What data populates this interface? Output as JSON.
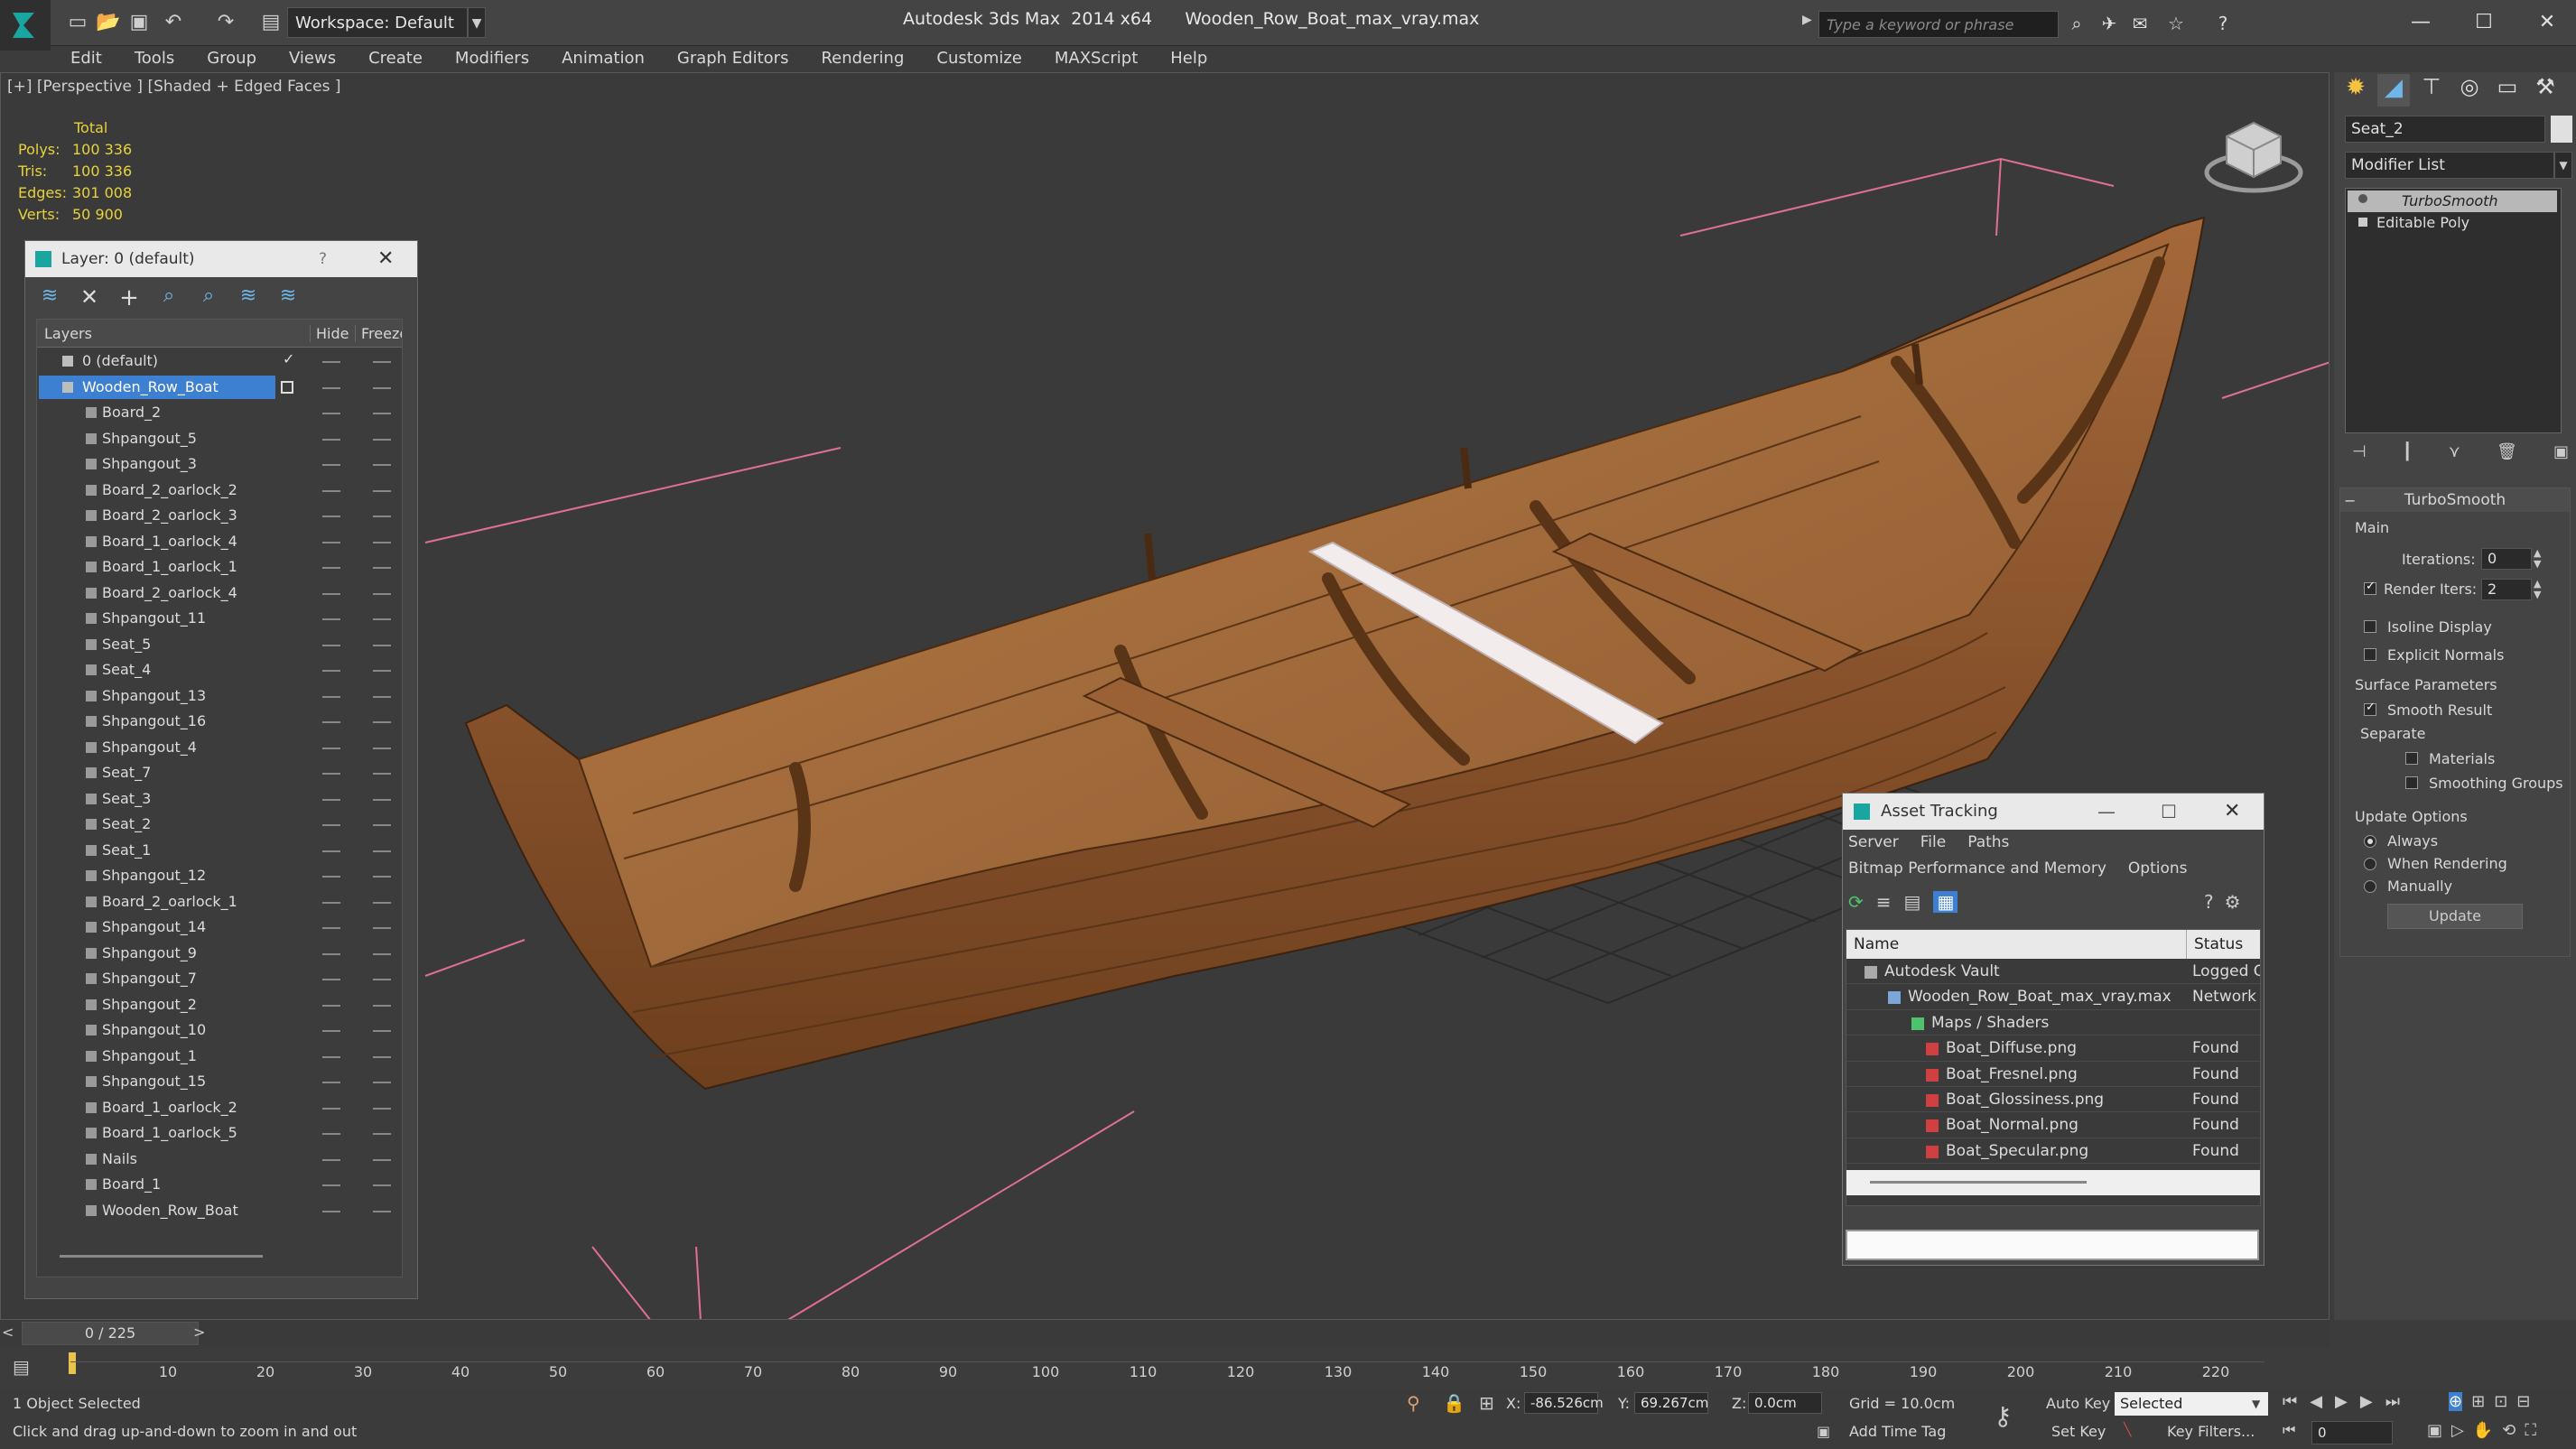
{
  "titlebar": {
    "workspace_label": "Workspace: Default",
    "app_name": "Autodesk 3ds Max",
    "app_version": "2014 x64",
    "file_name": "Wooden_Row_Boat_max_vray.max",
    "search_placeholder": "Type a keyword or phrase"
  },
  "menu": [
    "Edit",
    "Tools",
    "Group",
    "Views",
    "Create",
    "Modifiers",
    "Animation",
    "Graph Editors",
    "Rendering",
    "Customize",
    "MAXScript",
    "Help"
  ],
  "viewport": {
    "label": "[+] [Perspective ] [Shaded + Edged Faces ]",
    "stats": {
      "header": "Total",
      "rows": [
        {
          "label": "Polys:",
          "value": "100 336"
        },
        {
          "label": "Tris:",
          "value": "100 336"
        },
        {
          "label": "Edges:",
          "value": "301 008"
        },
        {
          "label": "Verts:",
          "value": "50 900"
        }
      ]
    }
  },
  "layer_panel": {
    "title": "Layer: 0 (default)",
    "help": "?",
    "col_layers": "Layers",
    "col_hide": "Hide",
    "col_freeze": "Freeze",
    "items": [
      "0 (default)",
      "Wooden_Row_Boat",
      "Board_2",
      "Shpangout_5",
      "Shpangout_3",
      "Board_2_oarlock_2",
      "Board_2_oarlock_3",
      "Board_1_oarlock_4",
      "Board_1_oarlock_1",
      "Board_2_oarlock_4",
      "Shpangout_11",
      "Seat_5",
      "Seat_4",
      "Shpangout_13",
      "Shpangout_16",
      "Shpangout_4",
      "Seat_7",
      "Seat_3",
      "Seat_2",
      "Seat_1",
      "Shpangout_12",
      "Board_2_oarlock_1",
      "Shpangout_14",
      "Shpangout_9",
      "Shpangout_7",
      "Shpangout_2",
      "Shpangout_10",
      "Shpangout_1",
      "Shpangout_15",
      "Board_1_oarlock_2",
      "Board_1_oarlock_5",
      "Nails",
      "Board_1",
      "Wooden_Row_Boat"
    ]
  },
  "command_panel": {
    "object_name": "Seat_2",
    "modifier_list": "Modifier List",
    "stack": [
      "TurboSmooth",
      "Editable Poly"
    ],
    "rollout_title": "TurboSmooth",
    "main_group": "Main",
    "iterations_label": "Iterations:",
    "iterations_value": "0",
    "render_iters_label": "Render Iters:",
    "render_iters_value": "2",
    "isoline": "Isoline Display",
    "explicit_normals": "Explicit Normals",
    "surface_group": "Surface Parameters",
    "smooth_result": "Smooth Result",
    "separate": "Separate",
    "materials": "Materials",
    "smoothing_groups": "Smoothing Groups",
    "update_group": "Update Options",
    "opt_always": "Always",
    "opt_when_rendering": "When Rendering",
    "opt_manually": "Manually",
    "update_button": "Update"
  },
  "asset_tracking": {
    "title": "Asset Tracking",
    "menu1": [
      "Server",
      "File",
      "Paths"
    ],
    "menu2": [
      "Bitmap Performance and Memory",
      "Options"
    ],
    "col_name": "Name",
    "col_status": "Status",
    "rows": [
      {
        "name": "Autodesk Vault",
        "status": "Logged O"
      },
      {
        "name": "Wooden_Row_Boat_max_vray.max",
        "status": "Network"
      },
      {
        "name": "Maps / Shaders",
        "status": ""
      },
      {
        "name": "Boat_Diffuse.png",
        "status": "Found"
      },
      {
        "name": "Boat_Fresnel.png",
        "status": "Found"
      },
      {
        "name": "Boat_Glossiness.png",
        "status": "Found"
      },
      {
        "name": "Boat_Normal.png",
        "status": "Found"
      },
      {
        "name": "Boat_Specular.png",
        "status": "Found"
      }
    ]
  },
  "timeline": {
    "frame": "0 / 225",
    "ticks": [
      "10",
      "20",
      "30",
      "40",
      "50",
      "60",
      "70",
      "80",
      "90",
      "100",
      "110",
      "120",
      "130",
      "140",
      "150",
      "160",
      "170",
      "180",
      "190",
      "200",
      "210",
      "220"
    ]
  },
  "status": {
    "selected": "1 Object Selected",
    "hint": "Click and drag up-and-down to zoom in and out",
    "x_label": "X:",
    "x_value": "-86.526cm",
    "y_label": "Y:",
    "y_value": "69.267cm",
    "z_label": "Z:",
    "z_value": "0.0cm",
    "grid": "Grid = 10.0cm",
    "add_time_tag": "Add Time Tag",
    "auto_key": "Auto Key",
    "set_key": "Set Key",
    "selected_dropdown": "Selected",
    "key_filters": "Key Filters...",
    "frame_field": "0"
  }
}
